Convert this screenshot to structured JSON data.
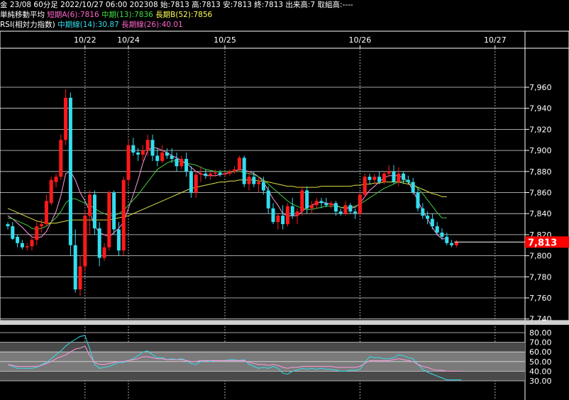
{
  "header": {
    "line1": "金 23/08 60分足 2022/10/27 06:00 202308 始:7813 高:7813 安:7813 終:7813 出来高:7 取組高:----",
    "ma_title": "単純移動平均",
    "ma_short": "短期A(6):7816",
    "ma_mid": "中期(13):7836",
    "ma_long": "長期B(52):7856",
    "rsi_title": "RSI(相対力指数)",
    "rsi_mid": "中期線(14):30.87",
    "rsi_long": "長期線(26):40.01"
  },
  "colors": {
    "up": "#ff1a1a",
    "down": "#33ddee",
    "ma_short": "#ff99dd",
    "ma_mid": "#44cc44",
    "ma_long": "#dddd44",
    "rsi_mid": "#33ddee",
    "rsi_long": "#ff99dd",
    "last_price_bg": "#ff0000"
  },
  "chart_data": [
    {
      "type": "candlestick",
      "title": "金 23/08 60分足",
      "date_labels": [
        "10/22",
        "10/24",
        "10/25",
        "10/26",
        "10/27"
      ],
      "date_label_bar_index": [
        16,
        25,
        45,
        73,
        101
      ],
      "y_ticks": [
        "7,960",
        "7,940",
        "7,920",
        "7,900",
        "7,880",
        "7,860",
        "7,840",
        "7,820",
        "7,800",
        "7,780",
        "7,760",
        "7,740"
      ],
      "ylim": [
        7740,
        7970
      ],
      "last_price": "7,813",
      "last_price_value": 7813,
      "ohlc": [
        [
          7830,
          7832,
          7825,
          7828
        ],
        [
          7828,
          7832,
          7815,
          7816
        ],
        [
          7818,
          7820,
          7808,
          7812
        ],
        [
          7812,
          7815,
          7806,
          7808
        ],
        [
          7808,
          7812,
          7805,
          7809
        ],
        [
          7809,
          7818,
          7805,
          7815
        ],
        [
          7815,
          7832,
          7810,
          7828
        ],
        [
          7828,
          7835,
          7822,
          7830
        ],
        [
          7830,
          7858,
          7828,
          7852
        ],
        [
          7850,
          7875,
          7848,
          7872
        ],
        [
          7870,
          7878,
          7865,
          7875
        ],
        [
          7875,
          7915,
          7872,
          7910
        ],
        [
          7910,
          7958,
          7905,
          7950
        ],
        [
          7950,
          7955,
          7800,
          7810
        ],
        [
          7810,
          7825,
          7765,
          7768
        ],
        [
          7768,
          7800,
          7762,
          7790
        ],
        [
          7790,
          7842,
          7785,
          7838
        ],
        [
          7838,
          7862,
          7820,
          7858
        ],
        [
          7858,
          7862,
          7820,
          7826
        ],
        [
          7826,
          7832,
          7790,
          7798
        ],
        [
          7798,
          7812,
          7795,
          7808
        ],
        [
          7808,
          7862,
          7805,
          7860
        ],
        [
          7860,
          7862,
          7820,
          7825
        ],
        [
          7825,
          7832,
          7800,
          7805
        ],
        [
          7805,
          7875,
          7800,
          7872
        ],
        [
          7872,
          7910,
          7868,
          7905
        ],
        [
          7905,
          7912,
          7895,
          7898
        ],
        [
          7898,
          7902,
          7890,
          7896
        ],
        [
          7896,
          7905,
          7890,
          7900
        ],
        [
          7900,
          7915,
          7895,
          7910
        ],
        [
          7910,
          7915,
          7890,
          7895
        ],
        [
          7895,
          7902,
          7885,
          7890
        ],
        [
          7890,
          7905,
          7888,
          7898
        ],
        [
          7898,
          7902,
          7892,
          7895
        ],
        [
          7895,
          7902,
          7888,
          7892
        ],
        [
          7892,
          7898,
          7880,
          7885
        ],
        [
          7885,
          7895,
          7882,
          7892
        ],
        [
          7892,
          7898,
          7875,
          7880
        ],
        [
          7880,
          7885,
          7855,
          7860
        ],
        [
          7860,
          7880,
          7855,
          7877
        ],
        [
          7877,
          7885,
          7870,
          7878
        ],
        [
          7878,
          7882,
          7873,
          7876
        ],
        [
          7876,
          7880,
          7872,
          7878
        ],
        [
          7878,
          7882,
          7875,
          7879
        ],
        [
          7879,
          7881,
          7875,
          7877
        ],
        [
          7877,
          7880,
          7875,
          7878
        ],
        [
          7878,
          7882,
          7876,
          7880
        ],
        [
          7880,
          7885,
          7878,
          7882
        ],
        [
          7882,
          7895,
          7880,
          7893
        ],
        [
          7893,
          7895,
          7865,
          7868
        ],
        [
          7868,
          7880,
          7862,
          7875
        ],
        [
          7875,
          7880,
          7865,
          7868
        ],
        [
          7868,
          7875,
          7860,
          7870
        ],
        [
          7870,
          7875,
          7858,
          7862
        ],
        [
          7862,
          7866,
          7840,
          7845
        ],
        [
          7845,
          7850,
          7830,
          7832
        ],
        [
          7832,
          7840,
          7825,
          7838
        ],
        [
          7838,
          7848,
          7825,
          7830
        ],
        [
          7830,
          7850,
          7828,
          7847
        ],
        [
          7847,
          7855,
          7835,
          7838
        ],
        [
          7838,
          7845,
          7830,
          7842
        ],
        [
          7842,
          7866,
          7838,
          7862
        ],
        [
          7862,
          7866,
          7840,
          7845
        ],
        [
          7845,
          7852,
          7840,
          7848
        ],
        [
          7848,
          7855,
          7845,
          7852
        ],
        [
          7852,
          7855,
          7845,
          7850
        ],
        [
          7850,
          7855,
          7846,
          7848
        ],
        [
          7848,
          7852,
          7845,
          7850
        ],
        [
          7850,
          7852,
          7838,
          7842
        ],
        [
          7842,
          7845,
          7838,
          7840
        ],
        [
          7840,
          7852,
          7838,
          7848
        ],
        [
          7848,
          7850,
          7840,
          7842
        ],
        [
          7842,
          7845,
          7835,
          7840
        ],
        [
          7840,
          7860,
          7838,
          7858
        ],
        [
          7858,
          7878,
          7855,
          7875
        ],
        [
          7875,
          7878,
          7868,
          7872
        ],
        [
          7872,
          7878,
          7868,
          7875
        ],
        [
          7875,
          7880,
          7868,
          7870
        ],
        [
          7870,
          7880,
          7868,
          7878
        ],
        [
          7878,
          7886,
          7875,
          7880
        ],
        [
          7880,
          7886,
          7868,
          7870
        ],
        [
          7870,
          7884,
          7866,
          7878
        ],
        [
          7878,
          7880,
          7868,
          7872
        ],
        [
          7872,
          7876,
          7868,
          7870
        ],
        [
          7870,
          7874,
          7858,
          7860
        ],
        [
          7860,
          7864,
          7842,
          7845
        ],
        [
          7845,
          7850,
          7835,
          7838
        ],
        [
          7838,
          7842,
          7830,
          7835
        ],
        [
          7835,
          7840,
          7825,
          7828
        ],
        [
          7828,
          7832,
          7820,
          7822
        ],
        [
          7822,
          7826,
          7815,
          7818
        ],
        [
          7818,
          7822,
          7810,
          7812
        ],
        [
          7812,
          7815,
          7808,
          7810
        ],
        [
          7810,
          7815,
          7808,
          7813
        ]
      ],
      "moving_averages": [
        {
          "name": "短期A(6)",
          "values": [
            7838,
            7835,
            7831,
            7827,
            7822,
            7818,
            7817,
            7818,
            7823,
            7832,
            7842,
            7857,
            7878,
            7880,
            7872,
            7860,
            7852,
            7842,
            7828,
            7822,
            7820,
            7818,
            7822,
            7826,
            7832,
            7845,
            7858,
            7872,
            7888,
            7900,
            7903,
            7902,
            7900,
            7898,
            7895,
            7893,
            7890,
            7888,
            7884,
            7880,
            7878,
            7876,
            7876,
            7876,
            7877,
            7878,
            7879,
            7880,
            7882,
            7881,
            7880,
            7878,
            7875,
            7870,
            7862,
            7854,
            7848,
            7840,
            7838,
            7838,
            7838,
            7842,
            7846,
            7848,
            7850,
            7851,
            7850,
            7849,
            7848,
            7846,
            7845,
            7845,
            7846,
            7850,
            7856,
            7862,
            7866,
            7870,
            7874,
            7876,
            7876,
            7876,
            7874,
            7870,
            7862,
            7852,
            7843,
            7835,
            7827,
            7820,
            7816,
            7816
          ]
        },
        {
          "name": "中期(13)",
          "values": [
            7836,
            7835,
            7833,
            7831,
            7829,
            7826,
            7825,
            7826,
            7828,
            7832,
            7836,
            7842,
            7850,
            7854,
            7854,
            7852,
            7850,
            7848,
            7845,
            7842,
            7840,
            7838,
            7838,
            7840,
            7843,
            7848,
            7853,
            7858,
            7864,
            7870,
            7876,
            7882,
            7885,
            7888,
            7890,
            7890,
            7889,
            7888,
            7887,
            7886,
            7884,
            7882,
            7881,
            7880,
            7880,
            7880,
            7880,
            7880,
            7880,
            7879,
            7878,
            7877,
            7875,
            7872,
            7868,
            7864,
            7860,
            7856,
            7852,
            7849,
            7847,
            7845,
            7844,
            7844,
            7845,
            7846,
            7847,
            7847,
            7847,
            7846,
            7846,
            7846,
            7847,
            7849,
            7852,
            7855,
            7858,
            7861,
            7864,
            7866,
            7868,
            7870,
            7871,
            7870,
            7868,
            7864,
            7859,
            7853,
            7847,
            7841,
            7836,
            7836
          ]
        },
        {
          "name": "長期B(52)",
          "values": [
            7845,
            7843,
            7841,
            7839,
            7837,
            7835,
            7833,
            7832,
            7831,
            7831,
            7831,
            7832,
            7833,
            7834,
            7834,
            7834,
            7834,
            7834,
            7834,
            7834,
            7834,
            7834,
            7835,
            7836,
            7837,
            7838,
            7840,
            7842,
            7844,
            7846,
            7848,
            7850,
            7852,
            7854,
            7856,
            7858,
            7860,
            7862,
            7864,
            7865,
            7866,
            7867,
            7868,
            7869,
            7870,
            7870,
            7871,
            7871,
            7872,
            7872,
            7872,
            7872,
            7871,
            7871,
            7870,
            7869,
            7868,
            7867,
            7866,
            7866,
            7865,
            7865,
            7865,
            7865,
            7865,
            7866,
            7866,
            7866,
            7866,
            7866,
            7866,
            7866,
            7867,
            7867,
            7868,
            7868,
            7869,
            7869,
            7870,
            7870,
            7870,
            7870,
            7869,
            7868,
            7867,
            7865,
            7863,
            7861,
            7859,
            7858,
            7856,
            7856
          ]
        }
      ]
    },
    {
      "type": "line",
      "title": "RSI(相対力指数)",
      "y_ticks": [
        "80.00",
        "70.00",
        "60.00",
        "50.00",
        "40.00",
        "30.00"
      ],
      "ylim": [
        20,
        86
      ],
      "bands": [
        [
          30,
          70
        ],
        [
          40,
          60
        ]
      ],
      "series": [
        {
          "name": "中期線(14)",
          "values": [
            47,
            45,
            43,
            43,
            43,
            43,
            44,
            47,
            49,
            53,
            57,
            61,
            66,
            70,
            73,
            76,
            77,
            63,
            47,
            43,
            44,
            45,
            47,
            49,
            49,
            51,
            53,
            56,
            60,
            61,
            57,
            54,
            54,
            52,
            53,
            52,
            53,
            51,
            48,
            47,
            50,
            51,
            50,
            51,
            51,
            51,
            52,
            52,
            51,
            52,
            47,
            45,
            43,
            44,
            43,
            45,
            43,
            38,
            37,
            40,
            41,
            43,
            42,
            43,
            42,
            43,
            42,
            42,
            41,
            40,
            40,
            41,
            41,
            42,
            49,
            55,
            54,
            54,
            53,
            53,
            54,
            57,
            56,
            54,
            53,
            47,
            42,
            39,
            37,
            35,
            33,
            31,
            31,
            31,
            31
          ]
        },
        {
          "name": "長期線(26)",
          "values": [
            47,
            46,
            45,
            45,
            45,
            45,
            45,
            46,
            48,
            50,
            53,
            55,
            57,
            60,
            63,
            64,
            66,
            56,
            49,
            47,
            47,
            48,
            49,
            50,
            50,
            51,
            52,
            53,
            55,
            55,
            54,
            53,
            53,
            52,
            52,
            52,
            52,
            51,
            50,
            50,
            51,
            51,
            51,
            51,
            51,
            51,
            51,
            51,
            51,
            51,
            49,
            48,
            47,
            47,
            46,
            47,
            46,
            44,
            43,
            44,
            44,
            45,
            45,
            45,
            45,
            45,
            45,
            45,
            44,
            44,
            44,
            44,
            44,
            45,
            48,
            51,
            51,
            51,
            51,
            51,
            52,
            53,
            52,
            51,
            50,
            47,
            45,
            44,
            42,
            41,
            41,
            40,
            40,
            40,
            40
          ]
        }
      ]
    }
  ]
}
